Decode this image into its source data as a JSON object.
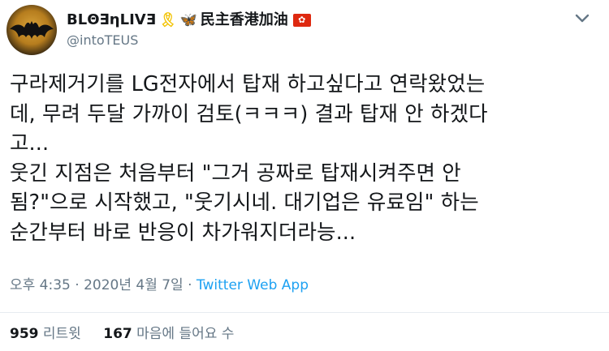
{
  "author": {
    "display_name": "BLΘ∃ηLIVƎ",
    "ribbon_icon": "yellow-ribbon-icon",
    "butterfly_icon": "butterfly-icon",
    "name_suffix": "民主香港加油",
    "flag_icon": "hong-kong-flag-icon",
    "flag_glyph": "✿",
    "handle": "@intoTEUS"
  },
  "tweet": {
    "lines": [
      "구라제거기를 LG전자에서 탑재 하고싶다고 연락왔었는",
      "데, 무려 두달 가까이 검토(ㅋㅋㅋ) 결과 탑재 안 하겠다",
      "고...",
      "웃긴 지점은 처음부터 \"그거 공짜로 탑재시켜주면 안",
      "됨?\"으로 시작했고, \"웃기시네. 대기업은 유료임\" 하는",
      "순간부터 바로 반응이 차가워지더라능..."
    ]
  },
  "meta": {
    "time": "오후 4:35",
    "separator": " · ",
    "date": "2020년 4월 7일",
    "source": "Twitter Web App"
  },
  "stats": {
    "retweets_count": "959",
    "retweets_label": "리트윗",
    "likes_count": "167",
    "likes_label": "마음에 들어요 수"
  },
  "colors": {
    "text": "#14171a",
    "muted": "#657786",
    "link": "#1da1f2",
    "divider": "#e6ecf0"
  }
}
